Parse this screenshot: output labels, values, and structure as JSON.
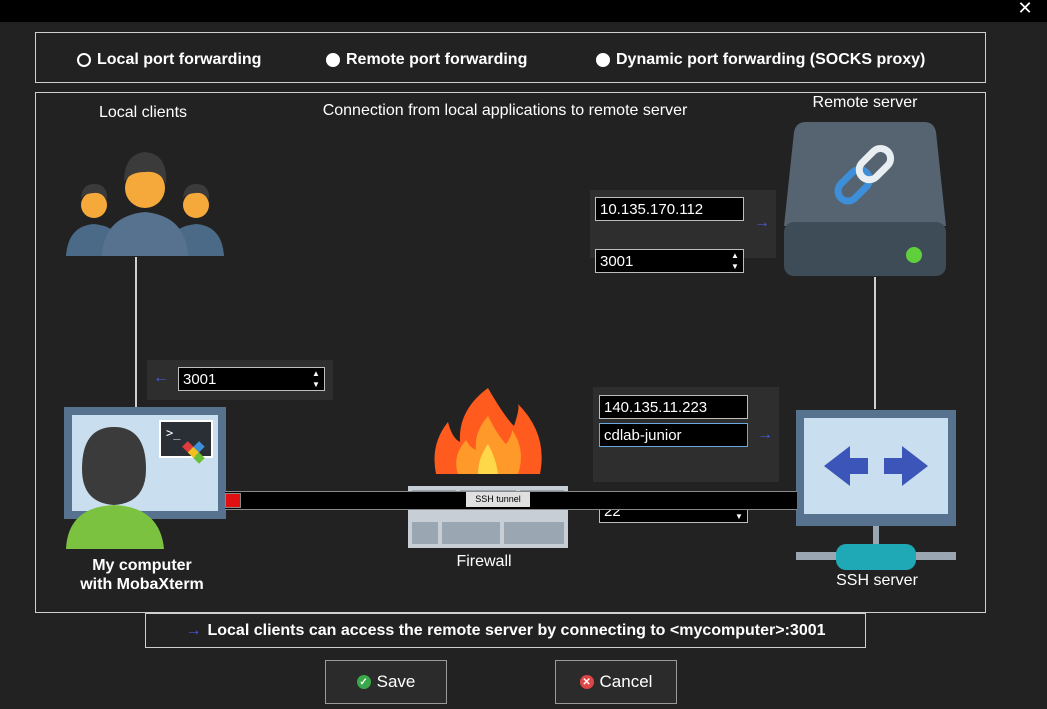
{
  "window": {
    "close_glyph": "✕"
  },
  "modes": [
    {
      "label": "Local port forwarding",
      "selected": true
    },
    {
      "label": "Remote port forwarding",
      "selected": false
    },
    {
      "label": "Dynamic port forwarding (SOCKS proxy)",
      "selected": false
    }
  ],
  "diagram": {
    "caption": "Connection from local applications to remote server",
    "local_clients_label": "Local clients",
    "remote_server_label": "Remote server",
    "my_computer_label_line1": "My computer",
    "my_computer_label_line2": "with MobaXterm",
    "firewall_label": "Firewall",
    "ssh_server_label": "SSH server",
    "tunnel_label": "SSH tunnel"
  },
  "local_port": {
    "value": "3001"
  },
  "remote": {
    "host": "10.135.170.112",
    "port": "3001"
  },
  "ssh": {
    "host": "140.135.11.223",
    "user": "cdlab-junior",
    "port": "22"
  },
  "info": {
    "arrow": "→",
    "text": "Local clients can access the remote server by connecting to <mycomputer>:3001"
  },
  "buttons": {
    "save": "Save",
    "cancel": "Cancel"
  },
  "colors": {
    "accent": "#4a58d8",
    "background": "#222222",
    "save_icon": "#3aa84a",
    "cancel_icon": "#e04545"
  }
}
